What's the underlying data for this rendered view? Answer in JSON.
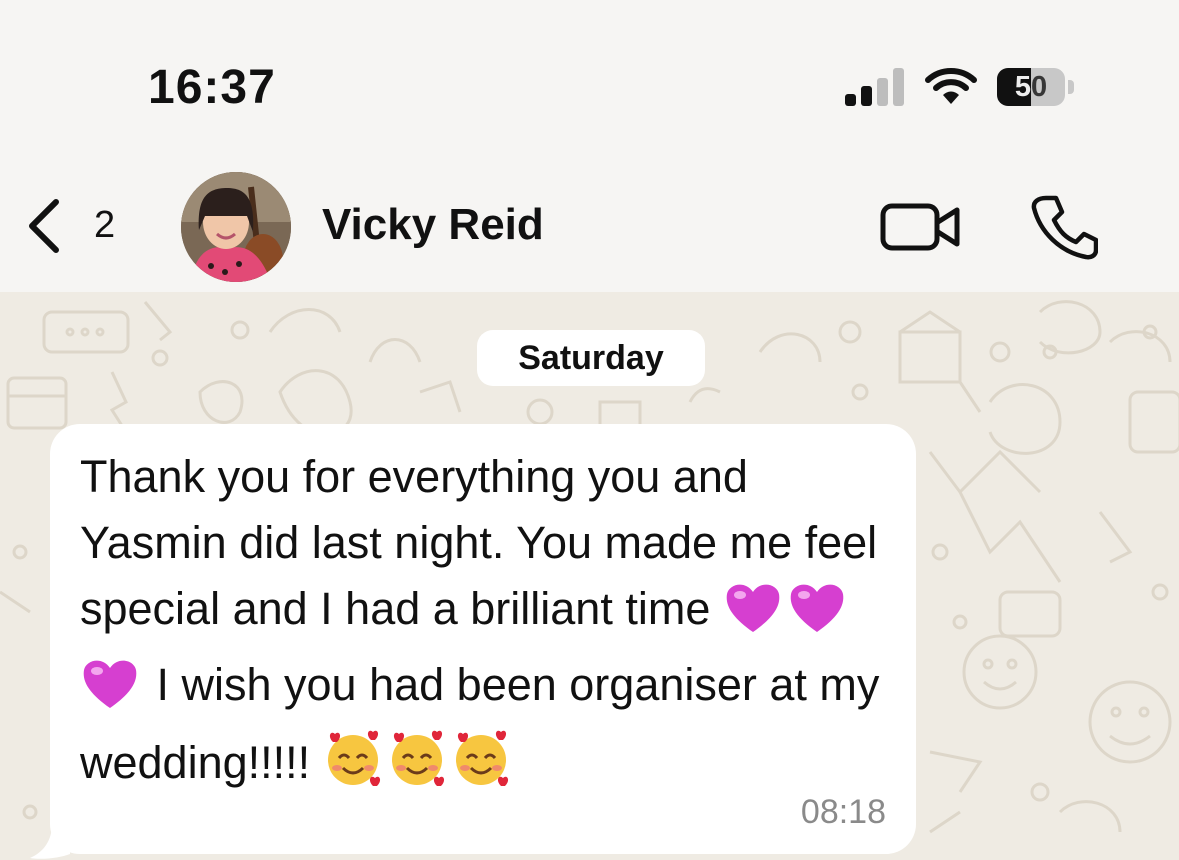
{
  "status_bar": {
    "time": "16:37",
    "battery_percent": "50",
    "battery_level": 0.5,
    "signal_bars_active": 2,
    "signal_bars_total": 4
  },
  "header": {
    "back_count": "2",
    "contact_name": "Vicky Reid",
    "back_icon": "chevron-left-icon",
    "video_icon": "video-camera-icon",
    "call_icon": "phone-icon"
  },
  "chat": {
    "date_label": "Saturday",
    "message": {
      "segments": [
        "Thank you for everything you and Yasmin did last night. You made me feel special and I had a brilliant time ",
        " I wish you had been organiser at my wedding!!!!! "
      ],
      "emoji_1": "purple-heart-emoji",
      "emoji_2": "smiling-face-with-hearts-emoji",
      "time": "08:18"
    }
  },
  "colors": {
    "chat_background": "#efebe3",
    "bubble": "#ffffff",
    "timestamp": "#8a8a8a",
    "heart": "#d63fd0"
  }
}
